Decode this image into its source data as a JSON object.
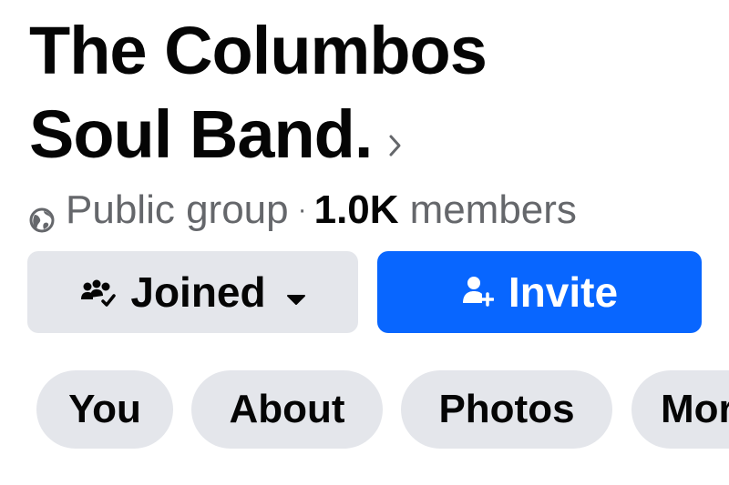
{
  "group": {
    "title_line1": "The Columbos",
    "title_line2": "Soul Band.",
    "privacy": "Public group",
    "separator": "·",
    "members_count": "1.0K",
    "members_label": "members"
  },
  "actions": {
    "joined_label": "Joined",
    "invite_label": "Invite"
  },
  "tabs": [
    {
      "label": "You"
    },
    {
      "label": "About"
    },
    {
      "label": "Photos"
    },
    {
      "label": "Mor"
    }
  ],
  "colors": {
    "primary": "#0866ff",
    "secondary_bg": "#e4e6eb",
    "secondary_text": "#65676b",
    "text": "#050505"
  },
  "icons": {
    "title": "chevron-right-icon",
    "privacy": "globe-icon",
    "joined": "group-joined-icon",
    "joined_menu": "caret-down-icon",
    "invite": "add-person-icon"
  }
}
